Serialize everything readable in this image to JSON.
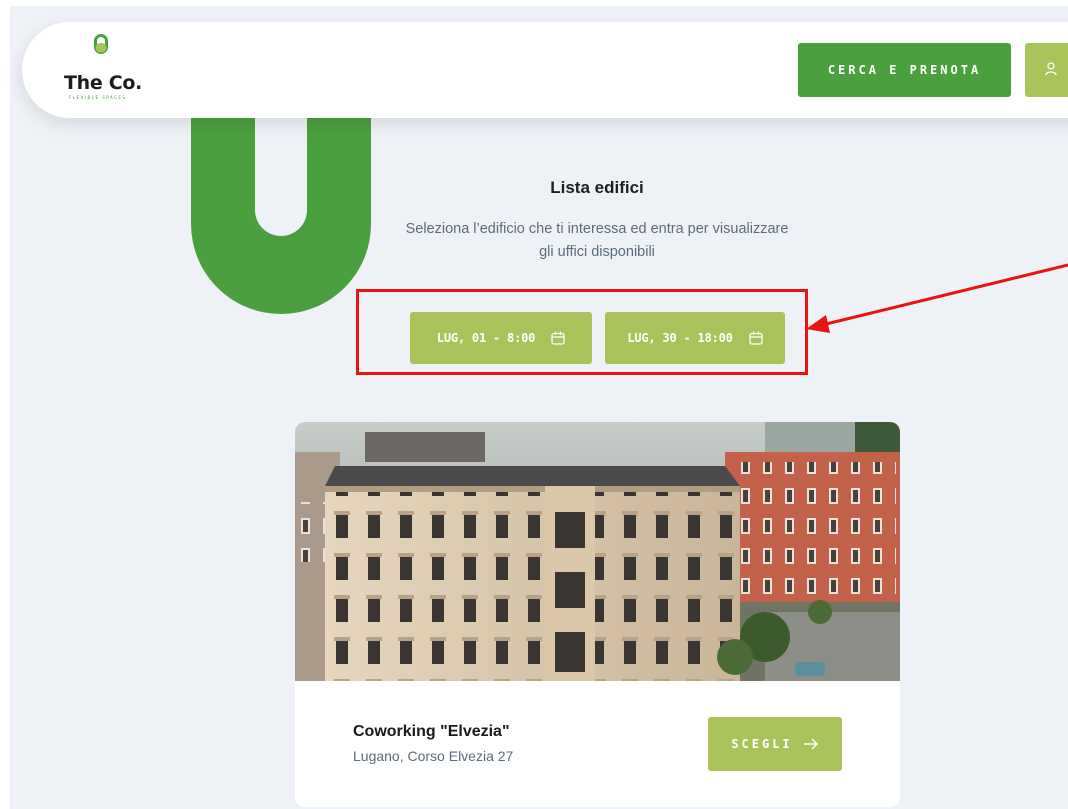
{
  "brand": {
    "name": "The Co.",
    "tagline": "FLEXIBLE SPACES",
    "green": "#4aa03e",
    "light_green": "#a9c25a"
  },
  "header": {
    "search_button": "CERCA E PRENOTA",
    "user_icon": "user-icon"
  },
  "intro": {
    "title": "Lista edifici",
    "subtitle": "Seleziona l’edificio che ti interessa ed entra per visualizzare gli uffici disponibili"
  },
  "filters": {
    "date_from": "LUG, 01 - 8:00",
    "date_to": "LUG, 30 - 18:00",
    "calendar_icon": "calendar-icon"
  },
  "annotation": {
    "color": "#ee1111"
  },
  "buildings": [
    {
      "name": "Coworking \"Elvezia\"",
      "address": "Lugano, Corso Elvezia 27",
      "button": "SCEGLI",
      "button_icon": "arrow-right-icon"
    }
  ]
}
